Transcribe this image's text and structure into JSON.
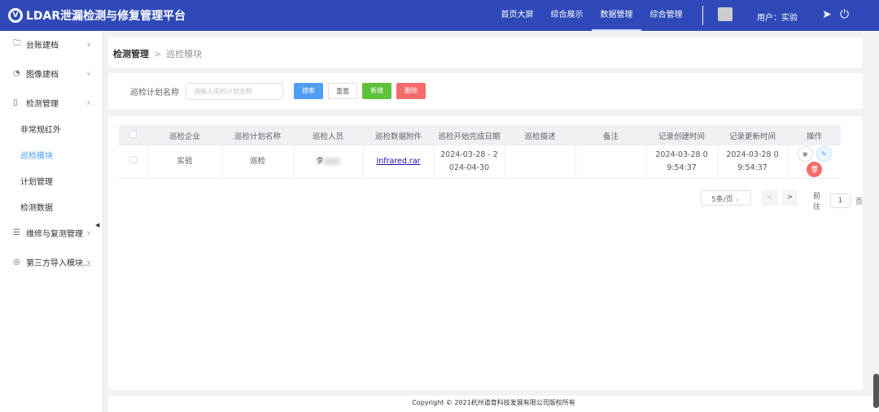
{
  "header": {
    "title": "LDAR泄漏检测与修复管理平台",
    "nav": [
      "首页大屏",
      "综合展示",
      "数据管理",
      "综合管理"
    ],
    "active_nav": 2,
    "user": "用户：实验"
  },
  "sidebar": {
    "items": [
      {
        "label": "台账建档",
        "icon": "folder-icon"
      },
      {
        "label": "图像建档",
        "icon": "image-icon"
      },
      {
        "label": "检测管理",
        "icon": "clipboard-icon"
      },
      {
        "label": "非常规红外",
        "sub": true
      },
      {
        "label": "巡检模块",
        "sub": true,
        "active": true
      },
      {
        "label": "计划管理",
        "sub": true
      },
      {
        "label": "检测数据",
        "sub": true
      },
      {
        "label": "维修与复测管理",
        "icon": "database-icon"
      },
      {
        "label": "第三方导入模块...",
        "icon": "import-icon"
      }
    ]
  },
  "breadcrumb": {
    "parent": "检测管理",
    "sep": ">",
    "current": "巡检模块"
  },
  "search": {
    "label": "巡检计划名称",
    "placeholder": "请输入巡检计划名称",
    "buttons": {
      "search": "搜索",
      "reset": "重置",
      "add": "新增",
      "delete": "删除"
    }
  },
  "table": {
    "headers": [
      "巡检企业",
      "巡检计划名称",
      "巡检人员",
      "巡检数据附件",
      "巡检开始完成日期",
      "巡检描述",
      "备注",
      "记录创建时间",
      "记录更新时间",
      "操作"
    ],
    "rows": [
      {
        "company": "实验",
        "plan": "巡检",
        "person": "李",
        "attachment": "Infrared.rar",
        "dates": "2024-03-28 - 2024-04-30",
        "desc": "",
        "remark": "",
        "created": "2024-03-28 09:54:37",
        "updated": "2024-03-28 09:54:37"
      }
    ]
  },
  "pagination": {
    "page_size": "5条/页",
    "goto_label": "前往",
    "page": "1",
    "page_suffix": "页"
  },
  "footer": "Copyright © 2021杭州道育科技发展有限公司版权所有"
}
